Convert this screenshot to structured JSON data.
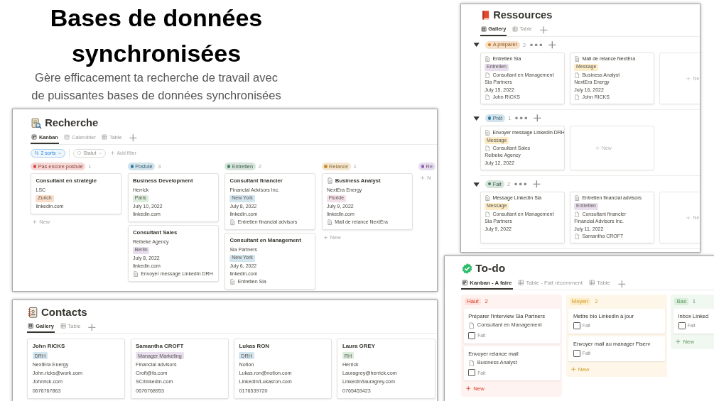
{
  "heading": "Bases de données synchronisées",
  "subtitle": "Gère efficacement ta recherche de travail avec de puissantes bases de données synchronisées",
  "recherche": {
    "title": "Recherche",
    "tabs": [
      {
        "kind": "board",
        "label": "Kanban",
        "selected": true
      },
      {
        "kind": "calendar",
        "label": "Calendrier",
        "selected": false
      },
      {
        "kind": "table",
        "label": "Table",
        "selected": false
      }
    ],
    "sort": "2 sorts",
    "filter": "Statut",
    "add_filter": "Add filter",
    "columns": [
      {
        "label": "Pas encore postulé",
        "color": "#d44c47",
        "count": "1",
        "new": "New",
        "cards": [
          {
            "title": "Consultant en stratégie",
            "has_icon": false,
            "company": "LSC",
            "tag": {
              "label": "Zurich",
              "color": "#fadec9"
            },
            "link": "linkedin.com"
          }
        ]
      },
      {
        "label": "Postulé",
        "color": "#337ea9",
        "count": "3",
        "cards": [
          {
            "title": "Business Development",
            "has_icon": false,
            "company": "Herrick",
            "tag": {
              "label": "Paris",
              "color": "#dbeddb"
            },
            "date": "July 10, 2022",
            "link": "linkedin.com"
          },
          {
            "title": "Consultant Sales",
            "has_icon": false,
            "company": "Reibeke Agency",
            "tag": {
              "label": "Berlin",
              "color": "#e8deee"
            },
            "date": "July 8, 2022",
            "link": "linkedin.com",
            "relation": "Envoyer message LinkedIn DRH"
          }
        ]
      },
      {
        "label": "Entretien",
        "color": "#448361",
        "count": "2",
        "cards": [
          {
            "title": "Consultant financier",
            "has_icon": false,
            "company": "Financial Advisors Inc.",
            "tag": {
              "label": "New York",
              "color": "#d3e5ef"
            },
            "date": "July 8, 2022",
            "link": "linkedin.com",
            "relation": "Entretien financial advisors"
          },
          {
            "title": "Consultant en Management",
            "has_icon": false,
            "company": "Sia Partners",
            "tag": {
              "label": "New York",
              "color": "#d3e5ef"
            },
            "date": "July 6, 2022",
            "link": "linkedin.com",
            "relation": "Entretien Sia"
          }
        ]
      },
      {
        "label": "Relancé",
        "color": "#cb912f",
        "count": "1",
        "new": "New",
        "cards": [
          {
            "title": "Business Analyst",
            "has_icon": true,
            "company": "NextEra Energy",
            "tag": {
              "label": "Floride",
              "color": "#f5e0e9"
            },
            "date": "July 9, 2022",
            "link": "linkedin.com",
            "relation": "Mail de relance NextEra"
          }
        ]
      },
      {
        "label": "Re",
        "color": "#9065b0",
        "new": "N"
      }
    ]
  },
  "contacts": {
    "title": "Contacts",
    "tabs": [
      {
        "kind": "gallery",
        "label": "Gallery",
        "selected": true
      },
      {
        "kind": "table",
        "label": "Table",
        "selected": false
      }
    ],
    "cards": [
      {
        "name": "John RICKS",
        "tag": {
          "label": "DRH",
          "color": "#d3e5ef"
        },
        "company": "NextEra Energy",
        "email": "John.ricks@work.com",
        "website": "Johnrick.com",
        "phone": "0676767863"
      },
      {
        "name": "Samantha CROFT",
        "tag": {
          "label": "Manager Marketing",
          "color": "#e8deee"
        },
        "company": "Financial advisors",
        "email": "Croft@fa.com",
        "website": "SC/linkedIn.com",
        "phone": "0676768953"
      },
      {
        "name": "Lukas RON",
        "tag": {
          "label": "DRH",
          "color": "#d3e5ef"
        },
        "company": "Notion",
        "email": "Lukas.ron@notion.com",
        "website": "LinkedIn/Lukasron.com",
        "phone": "0176539720"
      },
      {
        "name": "Laura GREY",
        "tag": {
          "label": "RH",
          "color": "#dbeddb"
        },
        "company": "Herrick",
        "email": "Lauragrey@herrick.com",
        "website": "LinkedIn/lauragrey.com",
        "phone": "0765453423"
      }
    ]
  },
  "ressources": {
    "title": "Ressources",
    "tabs": [
      {
        "kind": "gallery",
        "label": "Gallery",
        "selected": true
      },
      {
        "kind": "table",
        "label": "Table",
        "selected": false
      }
    ],
    "groups": [
      {
        "label": "A préparer",
        "color": "#d9730d",
        "count": "2",
        "expanded": true,
        "new": "Ne",
        "cards": [
          {
            "title": "Entretien Sia",
            "tag": {
              "label": "Entretien",
              "color": "#e8deee"
            },
            "relation": "Consultant en Management",
            "company": "Sia Partners",
            "date": "July 15, 2022",
            "person": "John RICKS"
          },
          {
            "title": "Mail de relance NextEra",
            "tag": {
              "label": "Message",
              "color": "#fdecc8"
            },
            "relation": "Business Analyst",
            "company": "NextEra Energy",
            "date": "July 16, 2022",
            "person": "John RICKS"
          }
        ]
      },
      {
        "label": "Prêt",
        "color": "#337ea9",
        "count": "1",
        "expanded": true,
        "new": "New",
        "cards": [
          {
            "title": "Envoyer message LinkedIn DRH",
            "tag": {
              "label": "Message",
              "color": "#fdecc8"
            },
            "relation": "Consultant Sales",
            "company": "Reibeke Agency",
            "date": "July 12, 2022"
          }
        ]
      },
      {
        "label": "Fait",
        "color": "#448361",
        "count": "2",
        "expanded": true,
        "new": "Ne",
        "cards": [
          {
            "title": "Message LinkedIn Sia",
            "tag": {
              "label": "Message",
              "color": "#fdecc8"
            },
            "relation": "Consultant en Management",
            "company": "Sia Partners",
            "date": "July 9, 2022"
          },
          {
            "title": "Entretien financial advisors",
            "tag": {
              "label": "Entretien",
              "color": "#e8deee"
            },
            "relation": "Consultant financier",
            "company": "Financial Advisors Inc.",
            "date": "July 11, 2022",
            "person": "Samantha CROFT"
          }
        ]
      }
    ]
  },
  "todo": {
    "title": "To-do",
    "tabs": [
      {
        "kind": "board",
        "label": "Kanban - A faire",
        "selected": true
      },
      {
        "kind": "table",
        "label": "Table - Fait récemment",
        "selected": false
      },
      {
        "kind": "table",
        "label": "Table",
        "selected": false
      }
    ],
    "columns": [
      {
        "label": "Haut",
        "color": "#ffe2dd",
        "count": "2",
        "new": "New",
        "cards": [
          {
            "title": "Préparer l'interview Sia Partners",
            "relation": "Consultant en Management",
            "check_label": "Fait",
            "checked": false
          },
          {
            "title": "Envoyer relance mail",
            "relation": "Business Analyst",
            "check_label": "Fait",
            "checked": false
          }
        ]
      },
      {
        "label": "Moyen",
        "color": "#fdecc8",
        "count": "2",
        "new": "New",
        "cards": [
          {
            "title": "Mettre bio LinkedIn à jour",
            "check_label": "Fait",
            "checked": false
          },
          {
            "title": "Envoyer mail au manager Fiserv",
            "check_label": "Fait",
            "checked": false
          }
        ]
      },
      {
        "label": "Bas",
        "color": "#dbeddb",
        "count": "1",
        "new": "New",
        "cards": [
          {
            "title": "Inbox Linked",
            "check_label": "Fait",
            "checked": false
          }
        ]
      }
    ]
  }
}
